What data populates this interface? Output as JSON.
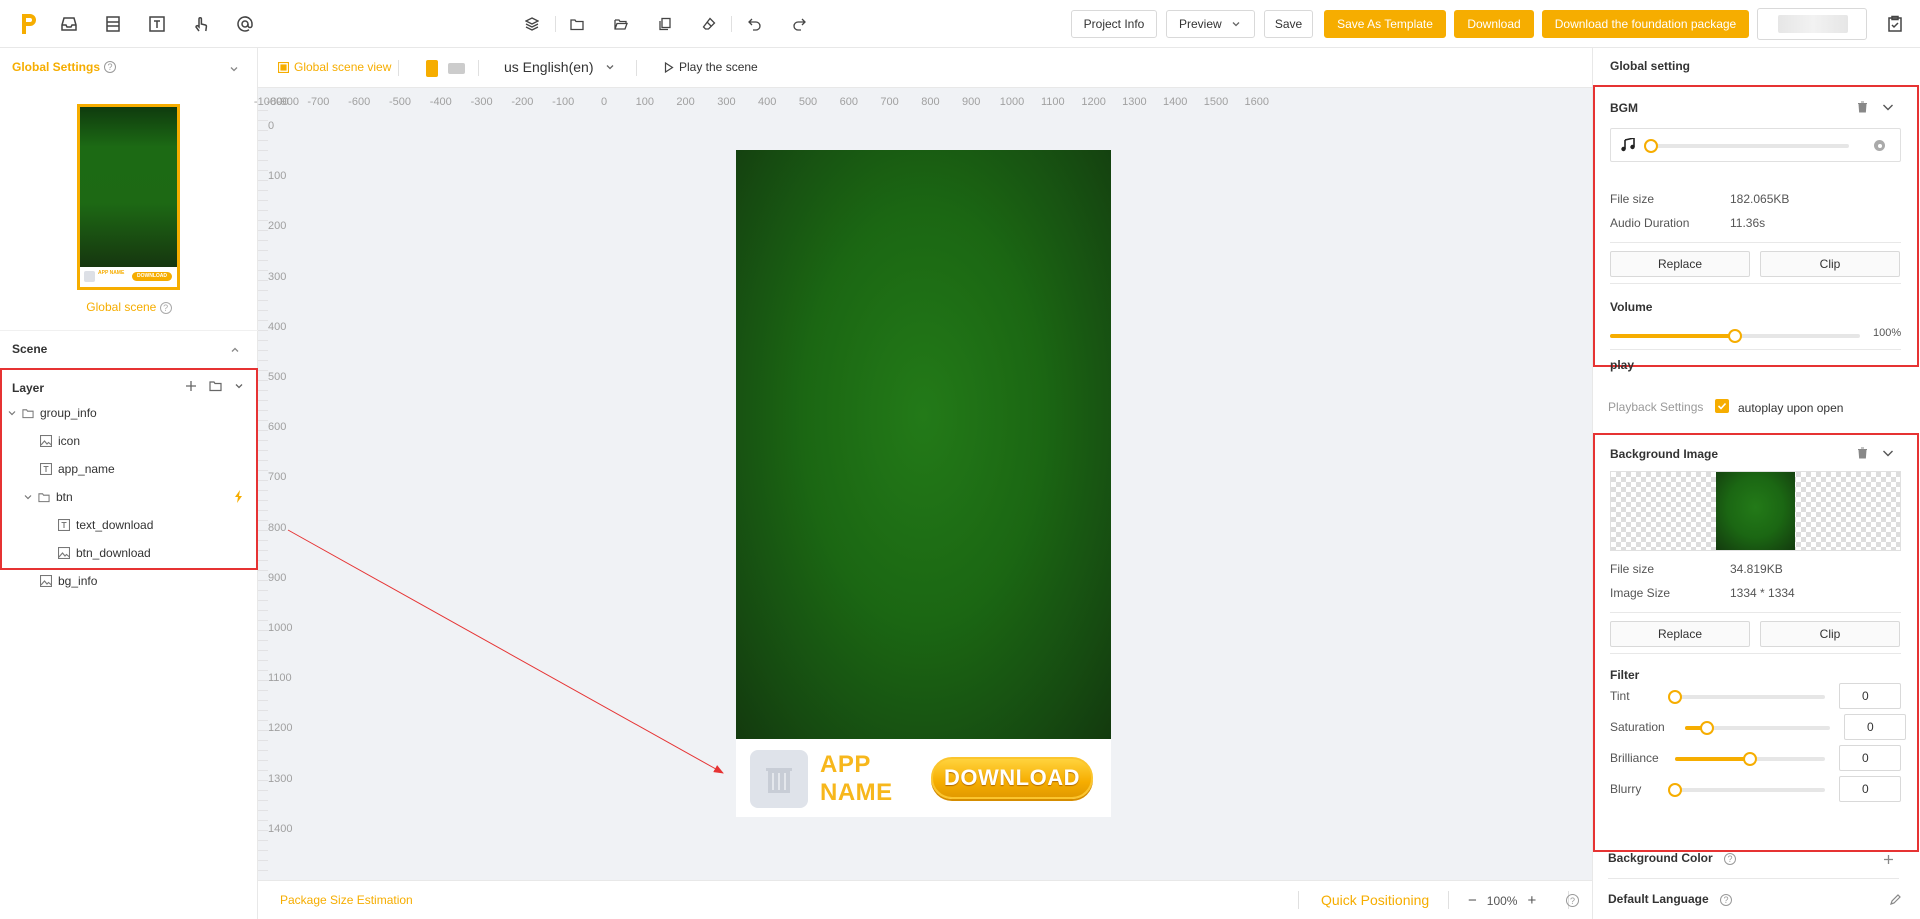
{
  "topbar": {
    "buttons": {
      "project_info": "Project Info",
      "preview": "Preview",
      "save": "Save",
      "save_as_template": "Save As Template",
      "download": "Download",
      "download_foundation": "Download the foundation package"
    },
    "accent_color": "#f6ad00"
  },
  "left": {
    "global_settings": "Global Settings",
    "global_scene": "Global scene",
    "thumb_app_name": "APP NAME",
    "thumb_download": "DOWNLOAD",
    "scene": "Scene",
    "layer": "Layer",
    "tree": [
      {
        "label": "group_info",
        "type": "folder"
      },
      {
        "label": "icon",
        "type": "image"
      },
      {
        "label": "app_name",
        "type": "text"
      },
      {
        "label": "btn",
        "type": "folder"
      },
      {
        "label": "text_download",
        "type": "text"
      },
      {
        "label": "btn_download",
        "type": "image"
      },
      {
        "label": "bg_info",
        "type": "image"
      }
    ]
  },
  "canvas": {
    "global_scene_view": "Global scene view",
    "language": "us English(en)",
    "play_scene": "Play the scene",
    "ruler_h": [
      "-1000",
      "-900",
      "-800",
      "-700",
      "-600",
      "-500",
      "-400",
      "-300",
      "-200",
      "-100",
      "0",
      "100",
      "200",
      "300",
      "400",
      "500",
      "600",
      "700",
      "800",
      "900",
      "1000",
      "1100",
      "1200",
      "1300",
      "1400",
      "1500",
      "1600"
    ],
    "ruler_v": [
      "0",
      "100",
      "200",
      "300",
      "400",
      "500",
      "600",
      "700",
      "800",
      "900",
      "1000",
      "1100",
      "1200",
      "1300",
      "1400"
    ],
    "app_name": "APP NAME",
    "download_btn": "DOWNLOAD",
    "package_size": "Package Size Estimation",
    "quick_positioning": "Quick Positioning",
    "zoom": "100%"
  },
  "right": {
    "title": "Global setting",
    "bgm": {
      "title": "BGM",
      "file_size_label": "File size",
      "file_size": "182.065KB",
      "duration_label": "Audio Duration",
      "duration": "11.36s",
      "replace": "Replace",
      "clip": "Clip",
      "volume_label": "Volume",
      "volume": "100%",
      "volume_fraction": 0.5,
      "play_label": "play",
      "playback_settings": "Playback Settings",
      "autoplay": "autoplay upon open"
    },
    "bg_image": {
      "title": "Background Image",
      "file_size_label": "File size",
      "file_size": "34.819KB",
      "image_size_label": "Image Size",
      "image_size": "1334 * 1334",
      "replace": "Replace",
      "clip": "Clip",
      "filter_label": "Filter",
      "filters": [
        {
          "label": "Tint",
          "value": "0",
          "fraction": 0.0
        },
        {
          "label": "Saturation",
          "value": "0",
          "fraction": 0.15
        },
        {
          "label": "Brilliance",
          "value": "0",
          "fraction": 0.5
        },
        {
          "label": "Blurry",
          "value": "0",
          "fraction": 0.0
        }
      ]
    },
    "background_color": "Background Color",
    "default_language": "Default Language"
  }
}
